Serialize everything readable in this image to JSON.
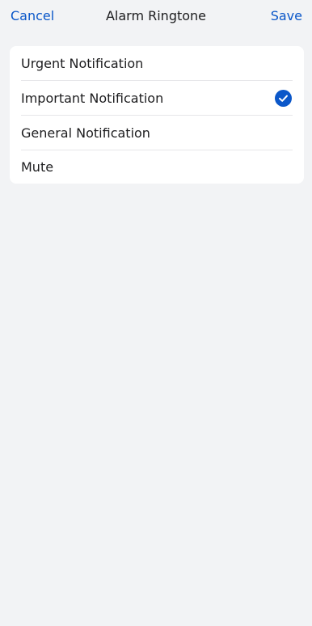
{
  "nav": {
    "cancel_label": "Cancel",
    "title": "Alarm Ringtone",
    "save_label": "Save"
  },
  "options": [
    {
      "label": "Urgent Notification",
      "selected": false
    },
    {
      "label": "Important Notification",
      "selected": true
    },
    {
      "label": "General Notification",
      "selected": false
    },
    {
      "label": "Mute",
      "selected": false
    }
  ],
  "icons": {
    "selected": "check-circle-icon"
  },
  "colors": {
    "accent": "#0b57c9",
    "background": "#f2f3f5",
    "card": "#ffffff",
    "text": "#1c1c1e"
  }
}
